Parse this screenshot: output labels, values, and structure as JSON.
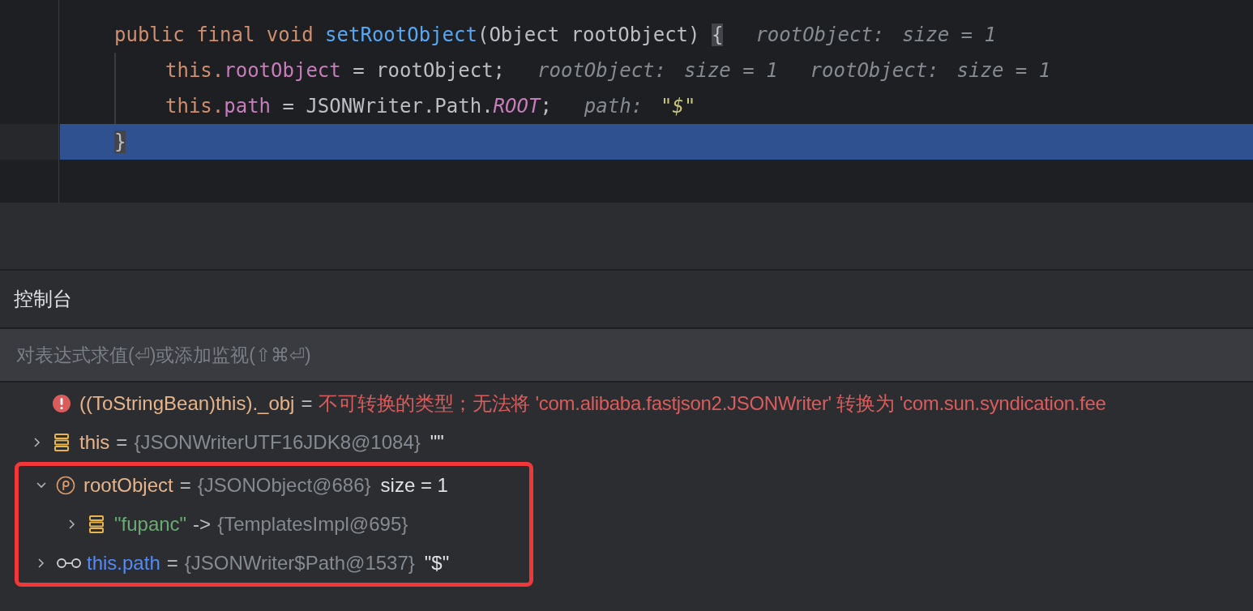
{
  "editor": {
    "lines": [
      {
        "current": false,
        "tokens": [
          {
            "text": "public final void ",
            "kind": "keyword"
          },
          {
            "text": "setRootObject",
            "kind": "method"
          },
          {
            "text": "(Object rootObject) ",
            "kind": "plain"
          },
          {
            "text": "{",
            "kind": "brace"
          }
        ],
        "hints": [
          {
            "label": "rootObject:",
            "value": "size = 1",
            "kind": "plain"
          }
        ],
        "children": [
          {
            "current": false,
            "tokens": [
              {
                "text": "this.",
                "kind": "keyword"
              },
              {
                "text": "rootObject",
                "kind": "field"
              },
              {
                "text": " = rootObject;",
                "kind": "plain"
              }
            ],
            "hints": [
              {
                "label": "rootObject:",
                "value": "size = 1",
                "kind": "plain"
              },
              {
                "label": "rootObject:",
                "value": "size = 1",
                "kind": "plain"
              }
            ]
          },
          {
            "current": false,
            "tokens": [
              {
                "text": "this.",
                "kind": "keyword"
              },
              {
                "text": "path",
                "kind": "field"
              },
              {
                "text": " = JSONWriter.Path.",
                "kind": "plain"
              },
              {
                "text": "ROOT",
                "kind": "static"
              },
              {
                "text": ";",
                "kind": "plain"
              }
            ],
            "hints": [
              {
                "label": "path:",
                "value": "\"$\"",
                "kind": "string"
              }
            ]
          }
        ]
      },
      {
        "current": true,
        "tokens": [
          {
            "text": "}",
            "kind": "brace"
          }
        ]
      }
    ]
  },
  "console": {
    "title": "控制台",
    "input": {
      "placeholder": "对表达式求值(⏎)或添加监视(⇧⌘⏎)"
    },
    "variables": [
      {
        "kind": "error",
        "name": "((ToStringBean)this)._obj",
        "separator": "=",
        "value": "不可转换的类型；无法将 'com.alibaba.fastjson2.JSONWriter' 转换为 'com.sun.syndication.fee"
      },
      {
        "kind": "field",
        "expanded": false,
        "name": "this",
        "separator": "=",
        "value": "{JSONWriterUTF16JDK8@1084}",
        "extra": "\"\""
      }
    ],
    "highlight_box": {
      "variables": [
        {
          "kind": "param",
          "expanded": true,
          "name": "rootObject",
          "separator": "=",
          "value": "{JSONObject@686}",
          "extra": "size = 1",
          "children": [
            {
              "kind": "entry",
              "expanded": false,
              "name": "\"fupanc\"",
              "separator": "->",
              "value": "{TemplatesImpl@695}"
            }
          ]
        },
        {
          "kind": "watch",
          "expanded": false,
          "name": "this.path",
          "separator": "=",
          "value": "{JSONWriter$Path@1537}",
          "extra": "\"$\""
        }
      ]
    }
  }
}
